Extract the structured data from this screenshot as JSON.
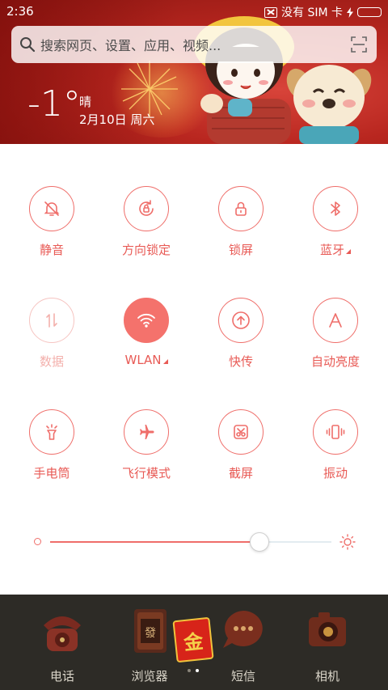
{
  "status": {
    "time": "2:36",
    "sim": "没有 SIM 卡"
  },
  "search": {
    "placeholder": "搜索网页、设置、应用、视频..."
  },
  "weather": {
    "temperature": "-1°",
    "condition": "晴",
    "date": "2月10日 周六"
  },
  "toggles": [
    {
      "label": "静音",
      "icon": "bell-off-icon",
      "state": "off"
    },
    {
      "label": "方向锁定",
      "icon": "rotation-lock-icon",
      "state": "off"
    },
    {
      "label": "锁屏",
      "icon": "lock-icon",
      "state": "off"
    },
    {
      "label": "蓝牙",
      "icon": "bluetooth-icon",
      "state": "off",
      "has_menu": true
    },
    {
      "label": "数据",
      "icon": "mobile-data-icon",
      "state": "disabled"
    },
    {
      "label": "WLAN",
      "icon": "wifi-icon",
      "state": "on",
      "has_menu": true
    },
    {
      "label": "快传",
      "icon": "quick-transfer-icon",
      "state": "off"
    },
    {
      "label": "自动亮度",
      "icon": "auto-brightness-icon",
      "state": "off"
    },
    {
      "label": "手电筒",
      "icon": "flashlight-icon",
      "state": "off"
    },
    {
      "label": "飞行模式",
      "icon": "airplane-icon",
      "state": "off"
    },
    {
      "label": "截屏",
      "icon": "screenshot-icon",
      "state": "off"
    },
    {
      "label": "振动",
      "icon": "vibrate-icon",
      "state": "off"
    }
  ],
  "brightness": {
    "level": 0.74
  },
  "dock": {
    "apps": [
      {
        "label": "电话",
        "icon": "phone-icon"
      },
      {
        "label": "浏览器",
        "icon": "browser-icon"
      },
      {
        "label": "短信",
        "icon": "messages-icon"
      },
      {
        "label": "相机",
        "icon": "camera-icon"
      }
    ],
    "envelope_char": "金",
    "page": 2,
    "pages": 2
  },
  "colors": {
    "accent": "#ef6e6a",
    "active": "#f4726c",
    "disabled": "#f6c4c1",
    "dock": "#2d2b26"
  }
}
